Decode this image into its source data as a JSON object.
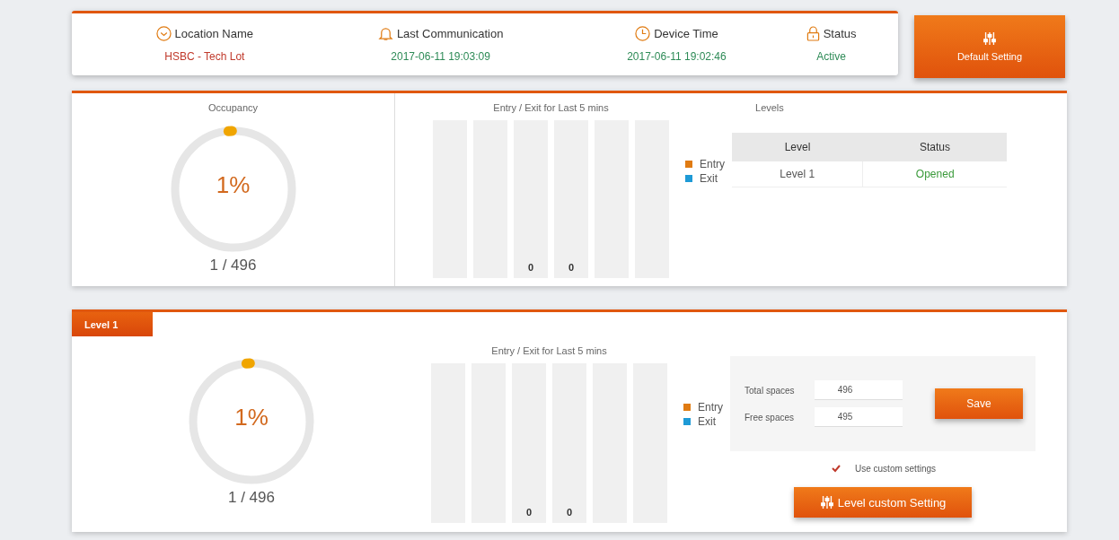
{
  "info": {
    "columns": [
      {
        "label": "Location Name",
        "value": "HSBC - Tech Lot",
        "color": "#c0392b"
      },
      {
        "label": "Last Communication",
        "value": "2017-06-11 19:03:09",
        "color": "#2e8b57"
      },
      {
        "label": "Device Time",
        "value": "2017-06-11 19:02:46",
        "color": "#2e8b57"
      },
      {
        "label": "Status",
        "value": "Active",
        "color": "#2e8b57"
      }
    ]
  },
  "default_button": {
    "label": "Default Setting"
  },
  "overview": {
    "occupancy": {
      "title": "Occupancy",
      "percent": "1%",
      "level": 0.01,
      "count": "1 / 496"
    },
    "chart": {
      "title": "Entry / Exit for Last 5 mins",
      "columns": [
        {
          "kind": "empty"
        },
        {
          "kind": "empty"
        },
        {
          "kind": "labeled",
          "label": "0"
        },
        {
          "kind": "labeled",
          "label": "0"
        },
        {
          "kind": "empty"
        },
        {
          "kind": "empty"
        }
      ],
      "legend": [
        {
          "label": "Entry",
          "color": "#e07b12"
        },
        {
          "label": "Exit",
          "color": "#1e9ad6"
        }
      ]
    },
    "levels": {
      "title": "Levels",
      "columns": [
        "Level",
        "Status"
      ],
      "rows": [
        {
          "level": "Level 1",
          "status": "Opened"
        }
      ]
    }
  },
  "level_panel": {
    "tabs": [
      {
        "label": "Level 1",
        "selected": true
      }
    ],
    "occupancy": {
      "percent": "1%",
      "level": 0.01,
      "count": "1 / 496"
    },
    "chart": {
      "title": "Entry / Exit for Last 5 mins",
      "columns": [
        {
          "kind": "empty"
        },
        {
          "kind": "empty"
        },
        {
          "kind": "labeled",
          "label": "0"
        },
        {
          "kind": "labeled",
          "label": "0"
        },
        {
          "kind": "empty"
        },
        {
          "kind": "empty"
        }
      ],
      "legend": [
        {
          "label": "Entry",
          "color": "#e07b12"
        },
        {
          "label": "Exit",
          "color": "#1e9ad6"
        }
      ]
    },
    "fields": [
      {
        "label": "Total spaces",
        "value": "496"
      },
      {
        "label": "Free spaces",
        "value": "495"
      }
    ],
    "save_button": {
      "label": "Save"
    },
    "custom": {
      "label": "Use custom settings",
      "checked": true
    },
    "custom_button": {
      "label": "Level custom Setting"
    }
  }
}
